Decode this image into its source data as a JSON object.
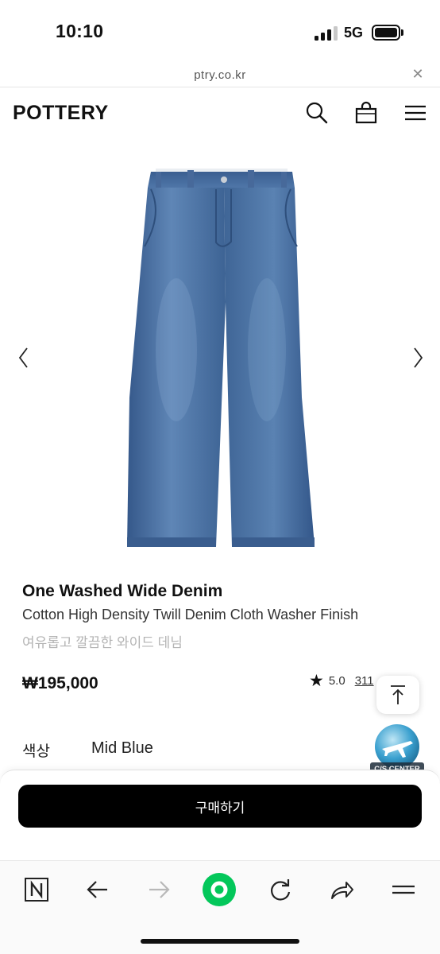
{
  "status_bar": {
    "time": "10:10",
    "network": "5G",
    "signal_bars_active": 3,
    "signal_bars_total": 4,
    "battery_level": 0.9
  },
  "browser": {
    "url": "ptry.co.kr",
    "close_icon": "close-icon"
  },
  "header": {
    "logo": "POTTERY",
    "icons": [
      "search-icon",
      "shopping-bag-icon",
      "menu-icon"
    ]
  },
  "product": {
    "image_icon": "denim-jeans-image",
    "title": "One Washed Wide Denim",
    "subtitle": "Cotton High Density Twill Denim Cloth Washer Finish",
    "description": "여유롭고 깔끔한 와이드 데님",
    "price": "₩195,000",
    "rating": "5.0",
    "review_count": "311",
    "option_label": "색상",
    "option_value": "Mid Blue"
  },
  "widgets": {
    "scroll_top_icon": "arrow-up-to-top-icon",
    "cs_badge_label": "C/S CENTER"
  },
  "purchase": {
    "buy_label": "구매하기"
  },
  "toolbar": {
    "icons": [
      "naver-n-icon",
      "back-arrow-icon",
      "forward-arrow-icon",
      "green-home-icon",
      "reload-icon",
      "share-icon",
      "menu-icon"
    ]
  },
  "colors": {
    "accent_green": "#03c75a",
    "denim": "#4a6d9a",
    "buy_button": "#000000"
  }
}
